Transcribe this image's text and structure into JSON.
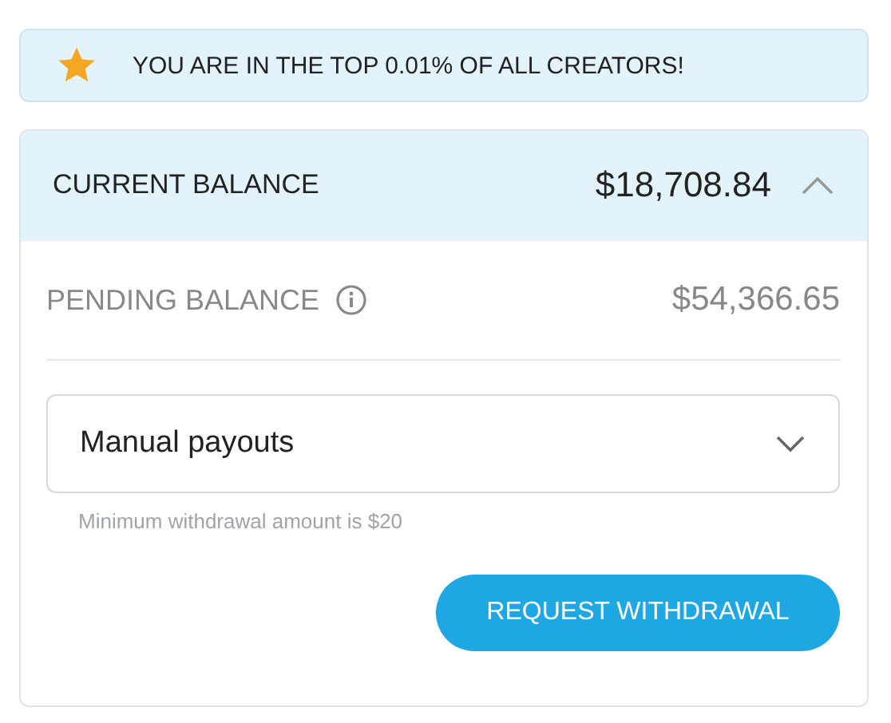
{
  "banner": {
    "text": "YOU ARE IN THE TOP 0.01% OF ALL CREATORS!"
  },
  "balance": {
    "label": "CURRENT BALANCE",
    "amount": "$18,708.84",
    "expanded": true,
    "pending": {
      "label": "PENDING BALANCE",
      "amount": "$54,366.65"
    },
    "payout_select": {
      "value": "Manual payouts"
    },
    "hint": "Minimum withdrawal amount is $20",
    "button": "REQUEST WITHDRAWAL"
  }
}
